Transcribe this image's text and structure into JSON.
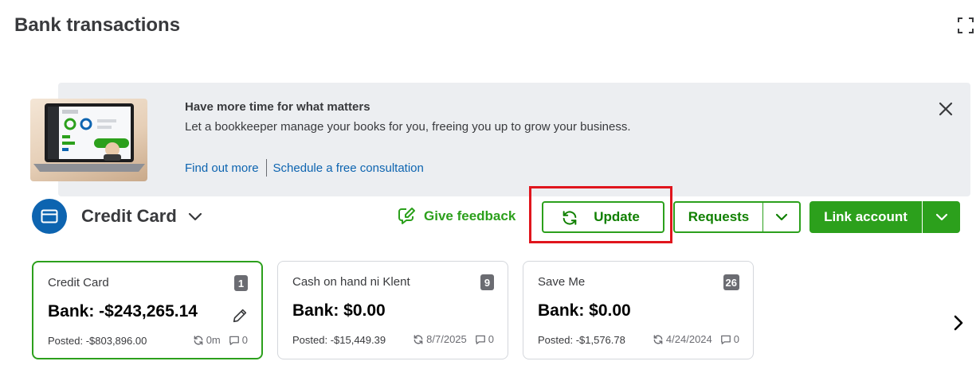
{
  "page": {
    "title": "Bank transactions"
  },
  "icons": {
    "expand": "expand-icon",
    "close": "close-icon",
    "account": "credit-card-icon",
    "feedback": "feedback-icon",
    "refresh": "refresh-icon",
    "edit": "pencil-icon",
    "comment": "comment-icon",
    "next": "chevron-right-icon"
  },
  "banner": {
    "title": "Have more time for what matters",
    "text": "Let a bookkeeper manage your books for you, freeing you up to grow your business.",
    "link_find_out": "Find out more",
    "link_schedule": "Schedule a free consultation"
  },
  "account": {
    "name": "Credit Card"
  },
  "toolbar": {
    "feedback_label": "Give feedback",
    "update_label": "Update",
    "requests_label": "Requests",
    "link_account_label": "Link account"
  },
  "cards": [
    {
      "name": "Credit Card",
      "count": "1",
      "bank": "Bank: -$243,265.14",
      "posted": "Posted: -$803,896.00",
      "sync": "0m",
      "comments": "0",
      "selected": true
    },
    {
      "name": "Cash on hand ni Klent",
      "count": "9",
      "bank": "Bank: $0.00",
      "posted": "Posted: -$15,449.39",
      "sync": "8/7/2025",
      "comments": "0",
      "selected": false
    },
    {
      "name": "Save Me",
      "count": "26",
      "bank": "Bank: $0.00",
      "posted": "Posted: -$1,576.78",
      "sync": "4/24/2024",
      "comments": "0",
      "selected": false
    }
  ],
  "colors": {
    "brand_green": "#2ca01c",
    "link_blue": "#0d64b0",
    "banner_bg": "#eceef1",
    "highlight": "#e0151d"
  }
}
